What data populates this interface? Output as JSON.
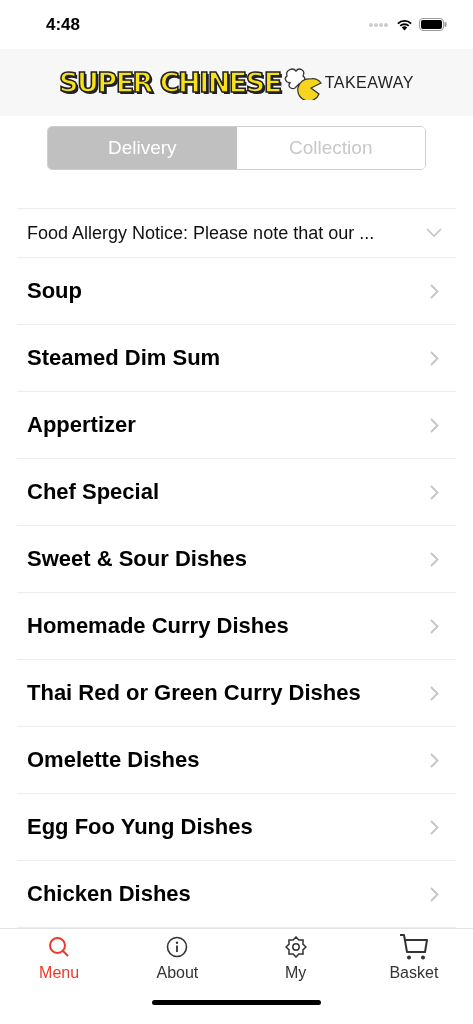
{
  "status_bar": {
    "time": "4:48"
  },
  "header": {
    "logo": {
      "brand": "SUPER CHINESE",
      "tagline": "TAKEAWAY"
    }
  },
  "order_type": [
    {
      "label": "Delivery",
      "selected": true
    },
    {
      "label": "Collection",
      "selected": false
    }
  ],
  "notice": {
    "text": "Food Allergy Notice: Please note that our ...",
    "expanded": false
  },
  "categories": [
    {
      "name": "Soup"
    },
    {
      "name": "Steamed Dim Sum"
    },
    {
      "name": "Appertizer"
    },
    {
      "name": "Chef Special"
    },
    {
      "name": "Sweet & Sour Dishes"
    },
    {
      "name": "Homemade Curry Dishes"
    },
    {
      "name": "Thai Red or Green Curry Dishes"
    },
    {
      "name": "Omelette Dishes"
    },
    {
      "name": "Egg Foo Yung Dishes"
    },
    {
      "name": "Chicken Dishes"
    }
  ],
  "tab_bar": [
    {
      "label": "Menu",
      "kind": "search",
      "selected": true
    },
    {
      "label": "About",
      "kind": "info",
      "selected": false
    },
    {
      "label": "My",
      "kind": "gear",
      "selected": false
    },
    {
      "label": "Basket",
      "kind": "cart",
      "selected": false
    }
  ]
}
